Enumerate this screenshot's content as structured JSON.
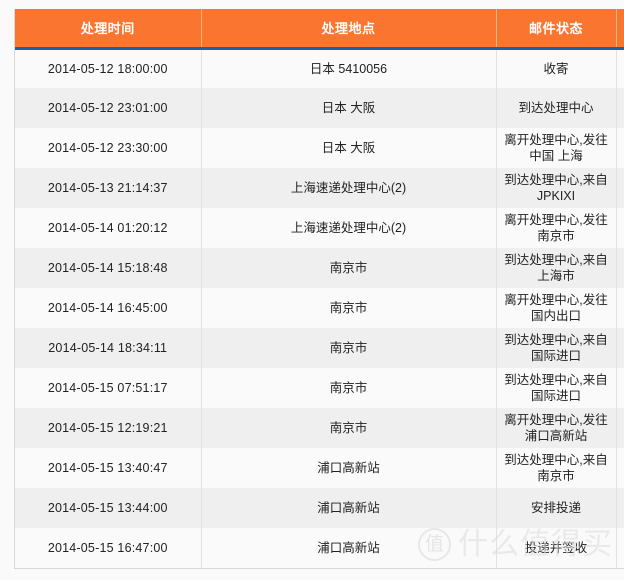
{
  "table": {
    "columns": [
      {
        "key": "time",
        "label": "处理时间"
      },
      {
        "key": "place",
        "label": "处理地点"
      },
      {
        "key": "status",
        "label": "邮件状态"
      },
      {
        "key": "extra",
        "label": ""
      }
    ],
    "rows": [
      {
        "time": "2014-05-12   18:00:00",
        "place": "日本 5410056",
        "status": "收寄",
        "extra": ""
      },
      {
        "time": "2014-05-12   23:01:00",
        "place": "日本 大阪",
        "status": "到达处理中心",
        "extra": ""
      },
      {
        "time": "2014-05-12   23:30:00",
        "place": "日本 大阪",
        "status": "离开处理中心,发往\n中国 上海",
        "extra": ""
      },
      {
        "time": "2014-05-13   21:14:37",
        "place": "上海速递处理中心(2)",
        "status": "到达处理中心,来自\nJPKIXI",
        "extra": ""
      },
      {
        "time": "2014-05-14   01:20:12",
        "place": "上海速递处理中心(2)",
        "status": "离开处理中心,发往\n南京市",
        "extra": ""
      },
      {
        "time": "2014-05-14   15:18:48",
        "place": "南京市",
        "status": "到达处理中心,来自\n上海市",
        "extra": ""
      },
      {
        "time": "2014-05-14   16:45:00",
        "place": "南京市",
        "status": "离开处理中心,发往\n国内出口",
        "extra": ""
      },
      {
        "time": "2014-05-14   18:34:11",
        "place": "南京市",
        "status": "到达处理中心,来自\n国际进口",
        "extra": ""
      },
      {
        "time": "2014-05-15   07:51:17",
        "place": "南京市",
        "status": "到达处理中心,来自\n国际进口",
        "extra": ""
      },
      {
        "time": "2014-05-15   12:19:21",
        "place": "南京市",
        "status": "离开处理中心,发往\n浦口高新站",
        "extra": ""
      },
      {
        "time": "2014-05-15   13:40:47",
        "place": "浦口高新站",
        "status": "到达处理中心,来自\n南京市",
        "extra": ""
      },
      {
        "time": "2014-05-15   13:44:00",
        "place": "浦口高新站",
        "status": "安排投递",
        "extra": ""
      },
      {
        "time": "2014-05-15   16:47:00",
        "place": "浦口高新站",
        "status": "投递并签收",
        "extra": ""
      }
    ]
  },
  "watermark": {
    "badge": "值",
    "text": "什么值得买"
  },
  "colors": {
    "header_bg": "#f97530",
    "header_rule": "#1464b4",
    "row_odd": "#fafafa",
    "row_even": "#efefef",
    "text": "#222222"
  }
}
